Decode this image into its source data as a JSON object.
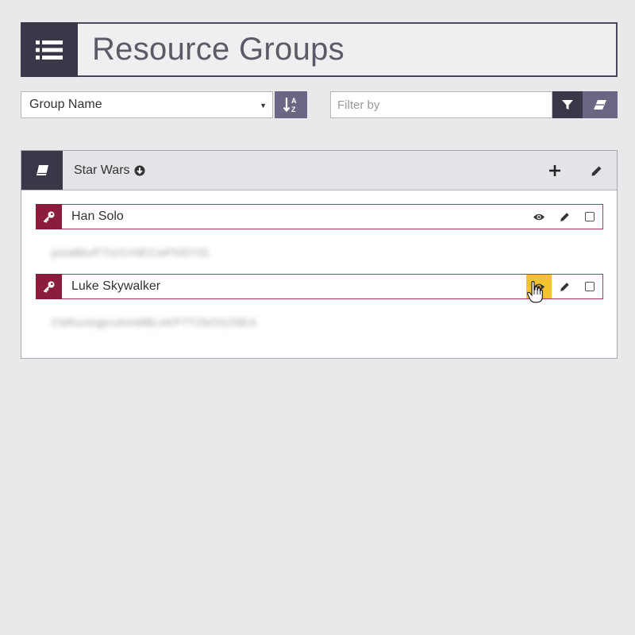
{
  "page": {
    "title": "Resource Groups"
  },
  "toolbar": {
    "sort_value": "Group Name",
    "filter_placeholder": "Filter by"
  },
  "group": {
    "name": "Star Wars",
    "resources": [
      {
        "name": "Han Solo",
        "secret": "psiaBkvP7UrCrNECwFhl5YIG"
      },
      {
        "name": "Luke Skywalker",
        "secret": "CbRuvtnjpcuhmMBLeKP7TZbOGZ8EA"
      }
    ]
  },
  "colors": {
    "dark": "#3a3848",
    "purple": "#6a6684",
    "crimson": "#8a1d3b",
    "highlight": "#f2c230"
  },
  "icons": {
    "header": "list-icon",
    "sort": "sort-alpha-icon",
    "filter": "funnel-icon",
    "clear": "eraser-icon",
    "group": "book-icon",
    "download": "download-circle-icon",
    "add": "plus-icon",
    "edit": "pencil-icon",
    "resource": "key-icon",
    "view": "eye-icon",
    "select": "checkbox-icon"
  }
}
